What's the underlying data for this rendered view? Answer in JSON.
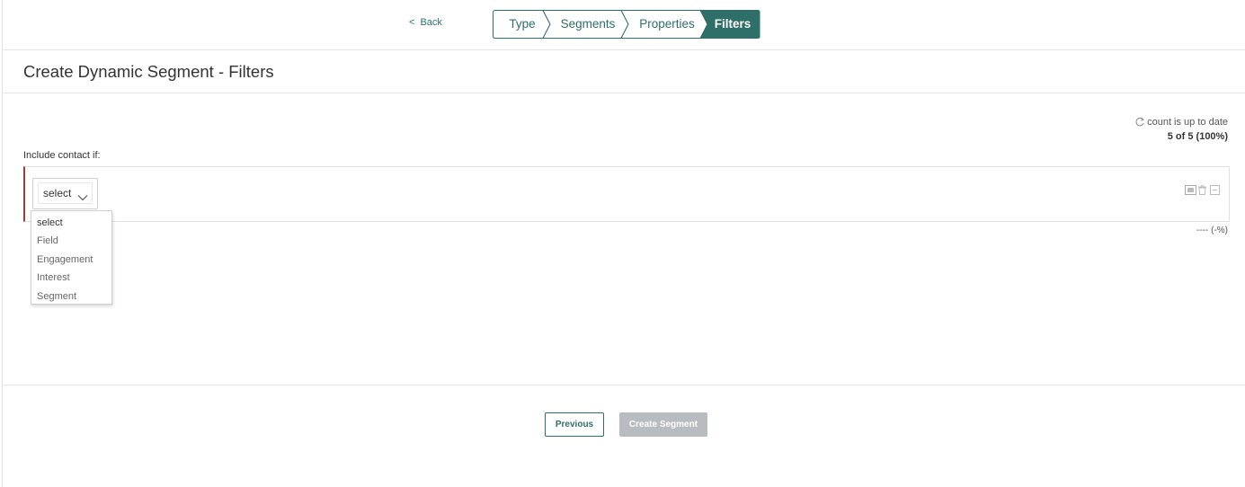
{
  "nav": {
    "back_label": "Back",
    "back_chevron": "<",
    "steps": [
      {
        "label": "Type",
        "active": false
      },
      {
        "label": "Segments",
        "active": false
      },
      {
        "label": "Properties",
        "active": false
      },
      {
        "label": "Filters",
        "active": true
      }
    ]
  },
  "page": {
    "title": "Create Dynamic Segment - Filters"
  },
  "count": {
    "status": "count is up to date",
    "value": "5 of 5 (100%)"
  },
  "filter": {
    "include_label": "Include contact if:",
    "select_value": "select",
    "options": [
      "select",
      "Field",
      "Engagement",
      "Interest",
      "Segment"
    ],
    "percentage": "---- (-%)"
  },
  "footer": {
    "previous_label": "Previous",
    "create_label": "Create Segment"
  },
  "colors": {
    "accent": "#2e6f6a",
    "disabled": "#b8bcc0",
    "filter_border": "#a33a3a"
  }
}
